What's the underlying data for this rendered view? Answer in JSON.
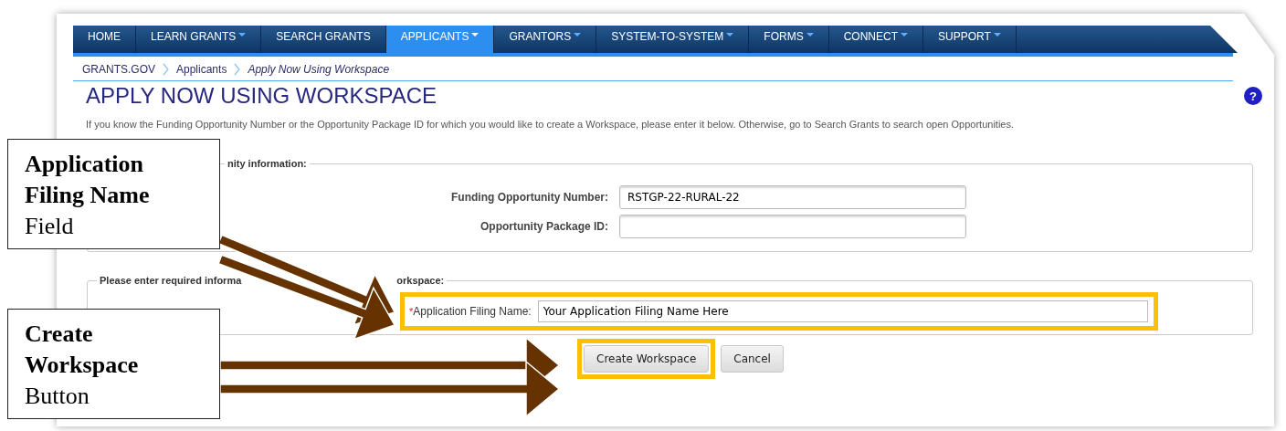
{
  "nav": [
    {
      "label": "HOME",
      "dropdown": false,
      "selected": false
    },
    {
      "label": "LEARN GRANTS",
      "dropdown": true,
      "selected": false
    },
    {
      "label": "SEARCH GRANTS",
      "dropdown": false,
      "selected": false
    },
    {
      "label": "APPLICANTS",
      "dropdown": true,
      "selected": true
    },
    {
      "label": "GRANTORS",
      "dropdown": true,
      "selected": false
    },
    {
      "label": "SYSTEM-TO-SYSTEM",
      "dropdown": true,
      "selected": false
    },
    {
      "label": "FORMS",
      "dropdown": true,
      "selected": false
    },
    {
      "label": "CONNECT",
      "dropdown": true,
      "selected": false
    },
    {
      "label": "SUPPORT",
      "dropdown": true,
      "selected": false
    }
  ],
  "breadcrumb": [
    {
      "label": "GRANTS.GOV",
      "current": false
    },
    {
      "label": "Applicants",
      "current": false
    },
    {
      "label": "Apply Now Using Workspace",
      "current": true
    }
  ],
  "title": "APPLY NOW USING WORKSPACE",
  "help": "?",
  "intro": {
    "before": "If you know the Funding Opportunity Number or the Opportunity Package ID for which you would like to create a Workspace, please enter it below. Otherwise, go to ",
    "link": "Search Grants",
    "after": " to search open Opportunities."
  },
  "opportunity_section": {
    "legend_parts": [
      "nity information:"
    ],
    "fields": [
      {
        "label": "Funding Opportunity Number:",
        "value": "RSTGP-22-RURAL-22"
      },
      {
        "label": "Opportunity Package ID:"
      }
    ]
  },
  "workspace_section": {
    "legend_parts": [
      "Please enter required informa",
      "orkspace:"
    ],
    "field": {
      "required_mark": "*",
      "label": "Application Filing Name:",
      "value": "Your Application Filing Name Here",
      "highlighted": true
    }
  },
  "buttons": [
    {
      "label": "Create Workspace",
      "highlighted": true
    },
    {
      "label": "Cancel",
      "highlighted": false
    }
  ],
  "callouts": [
    {
      "bold": "Application Filing Name",
      "plain": "Field"
    },
    {
      "bold": "Create Workspace",
      "plain": "Button"
    }
  ]
}
